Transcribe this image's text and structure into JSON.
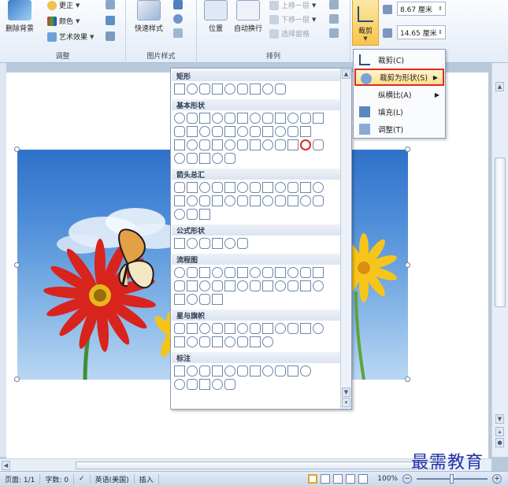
{
  "ribbon": {
    "adjust": {
      "remove_bg": "删除背景",
      "corrections": "更正",
      "color": "颜色",
      "artistic": "艺术效果",
      "label": "调整"
    },
    "picture_styles": {
      "quick_styles": "快速样式",
      "label": "图片样式"
    },
    "arrange": {
      "position": "位置",
      "wrap_text": "自动换行",
      "bring_forward": "上移一层",
      "send_backward": "下移一层",
      "selection_pane": "选择窗格",
      "label": "排列"
    },
    "size": {
      "crop": "裁剪",
      "height": "8.67 厘米",
      "width": "14.65 厘米"
    }
  },
  "crop_menu": {
    "items": [
      {
        "label": "裁剪(C)",
        "has_submenu": false
      },
      {
        "label": "裁剪为形状(S)",
        "has_submenu": true,
        "highlighted": true
      },
      {
        "label": "纵横比(A)",
        "has_submenu": true
      },
      {
        "label": "填充(L)",
        "has_submenu": false
      },
      {
        "label": "调整(T)",
        "has_submenu": false
      }
    ]
  },
  "shapes_gallery": {
    "sections": [
      {
        "title": "矩形",
        "rows": [
          9
        ]
      },
      {
        "title": "基本形状",
        "rows": [
          12,
          11,
          12,
          5
        ]
      },
      {
        "title": "箭头总汇",
        "rows": [
          12,
          12,
          3
        ]
      },
      {
        "title": "公式形状",
        "rows": [
          6
        ]
      },
      {
        "title": "流程图",
        "rows": [
          12,
          12,
          4
        ]
      },
      {
        "title": "星与旗帜",
        "rows": [
          12,
          8
        ]
      },
      {
        "title": "标注",
        "rows": [
          11,
          5
        ]
      }
    ],
    "selected": {
      "section": 1,
      "row": 2,
      "index": 10
    }
  },
  "status_bar": {
    "page": "页面: 1/1",
    "words": "字数: 0",
    "language": "英语(美国)",
    "mode": "插入",
    "zoom": "100%"
  },
  "watermark": "最需教育",
  "colors": {
    "accent": "#d92a2a",
    "highlight": "#fddf8a",
    "sky": "#4c8cd8"
  }
}
